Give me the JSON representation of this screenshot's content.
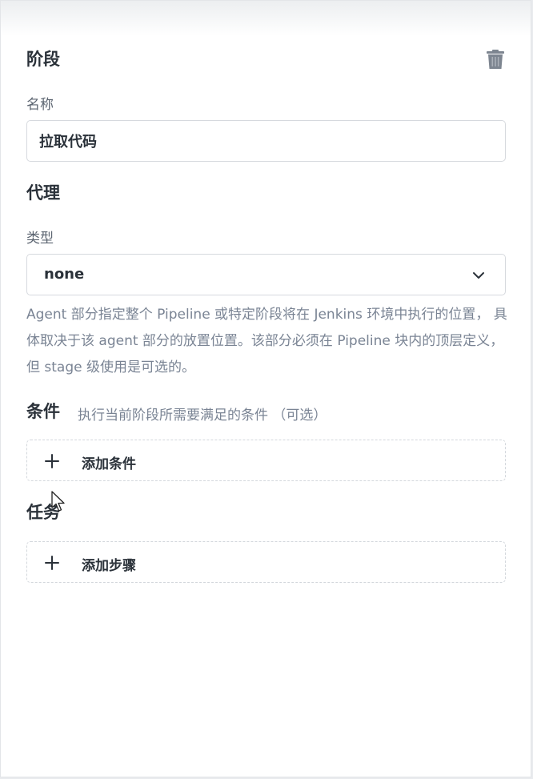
{
  "stage": {
    "title": "阶段",
    "delete_icon": "trash-icon",
    "name_label": "名称",
    "name_value": "拉取代码"
  },
  "agent": {
    "title": "代理",
    "type_label": "类型",
    "type_value": "none",
    "help": "Agent 部分指定整个 Pipeline 或特定阶段将在 Jenkins 环境中执行的位置， 具体取决于该 agent 部分的放置位置。该部分必须在 Pipeline 块内的顶层定义，但 stage 级使用是可选的。"
  },
  "conditions": {
    "title": "条件",
    "description": "执行当前阶段所需要满足的条件 （可选）",
    "add_label": "添加条件"
  },
  "tasks": {
    "title": "任务",
    "add_label": "添加步骤"
  },
  "colors": {
    "text_primary": "#2a3139",
    "text_secondary": "#7a8494",
    "border": "#d6d9de"
  }
}
